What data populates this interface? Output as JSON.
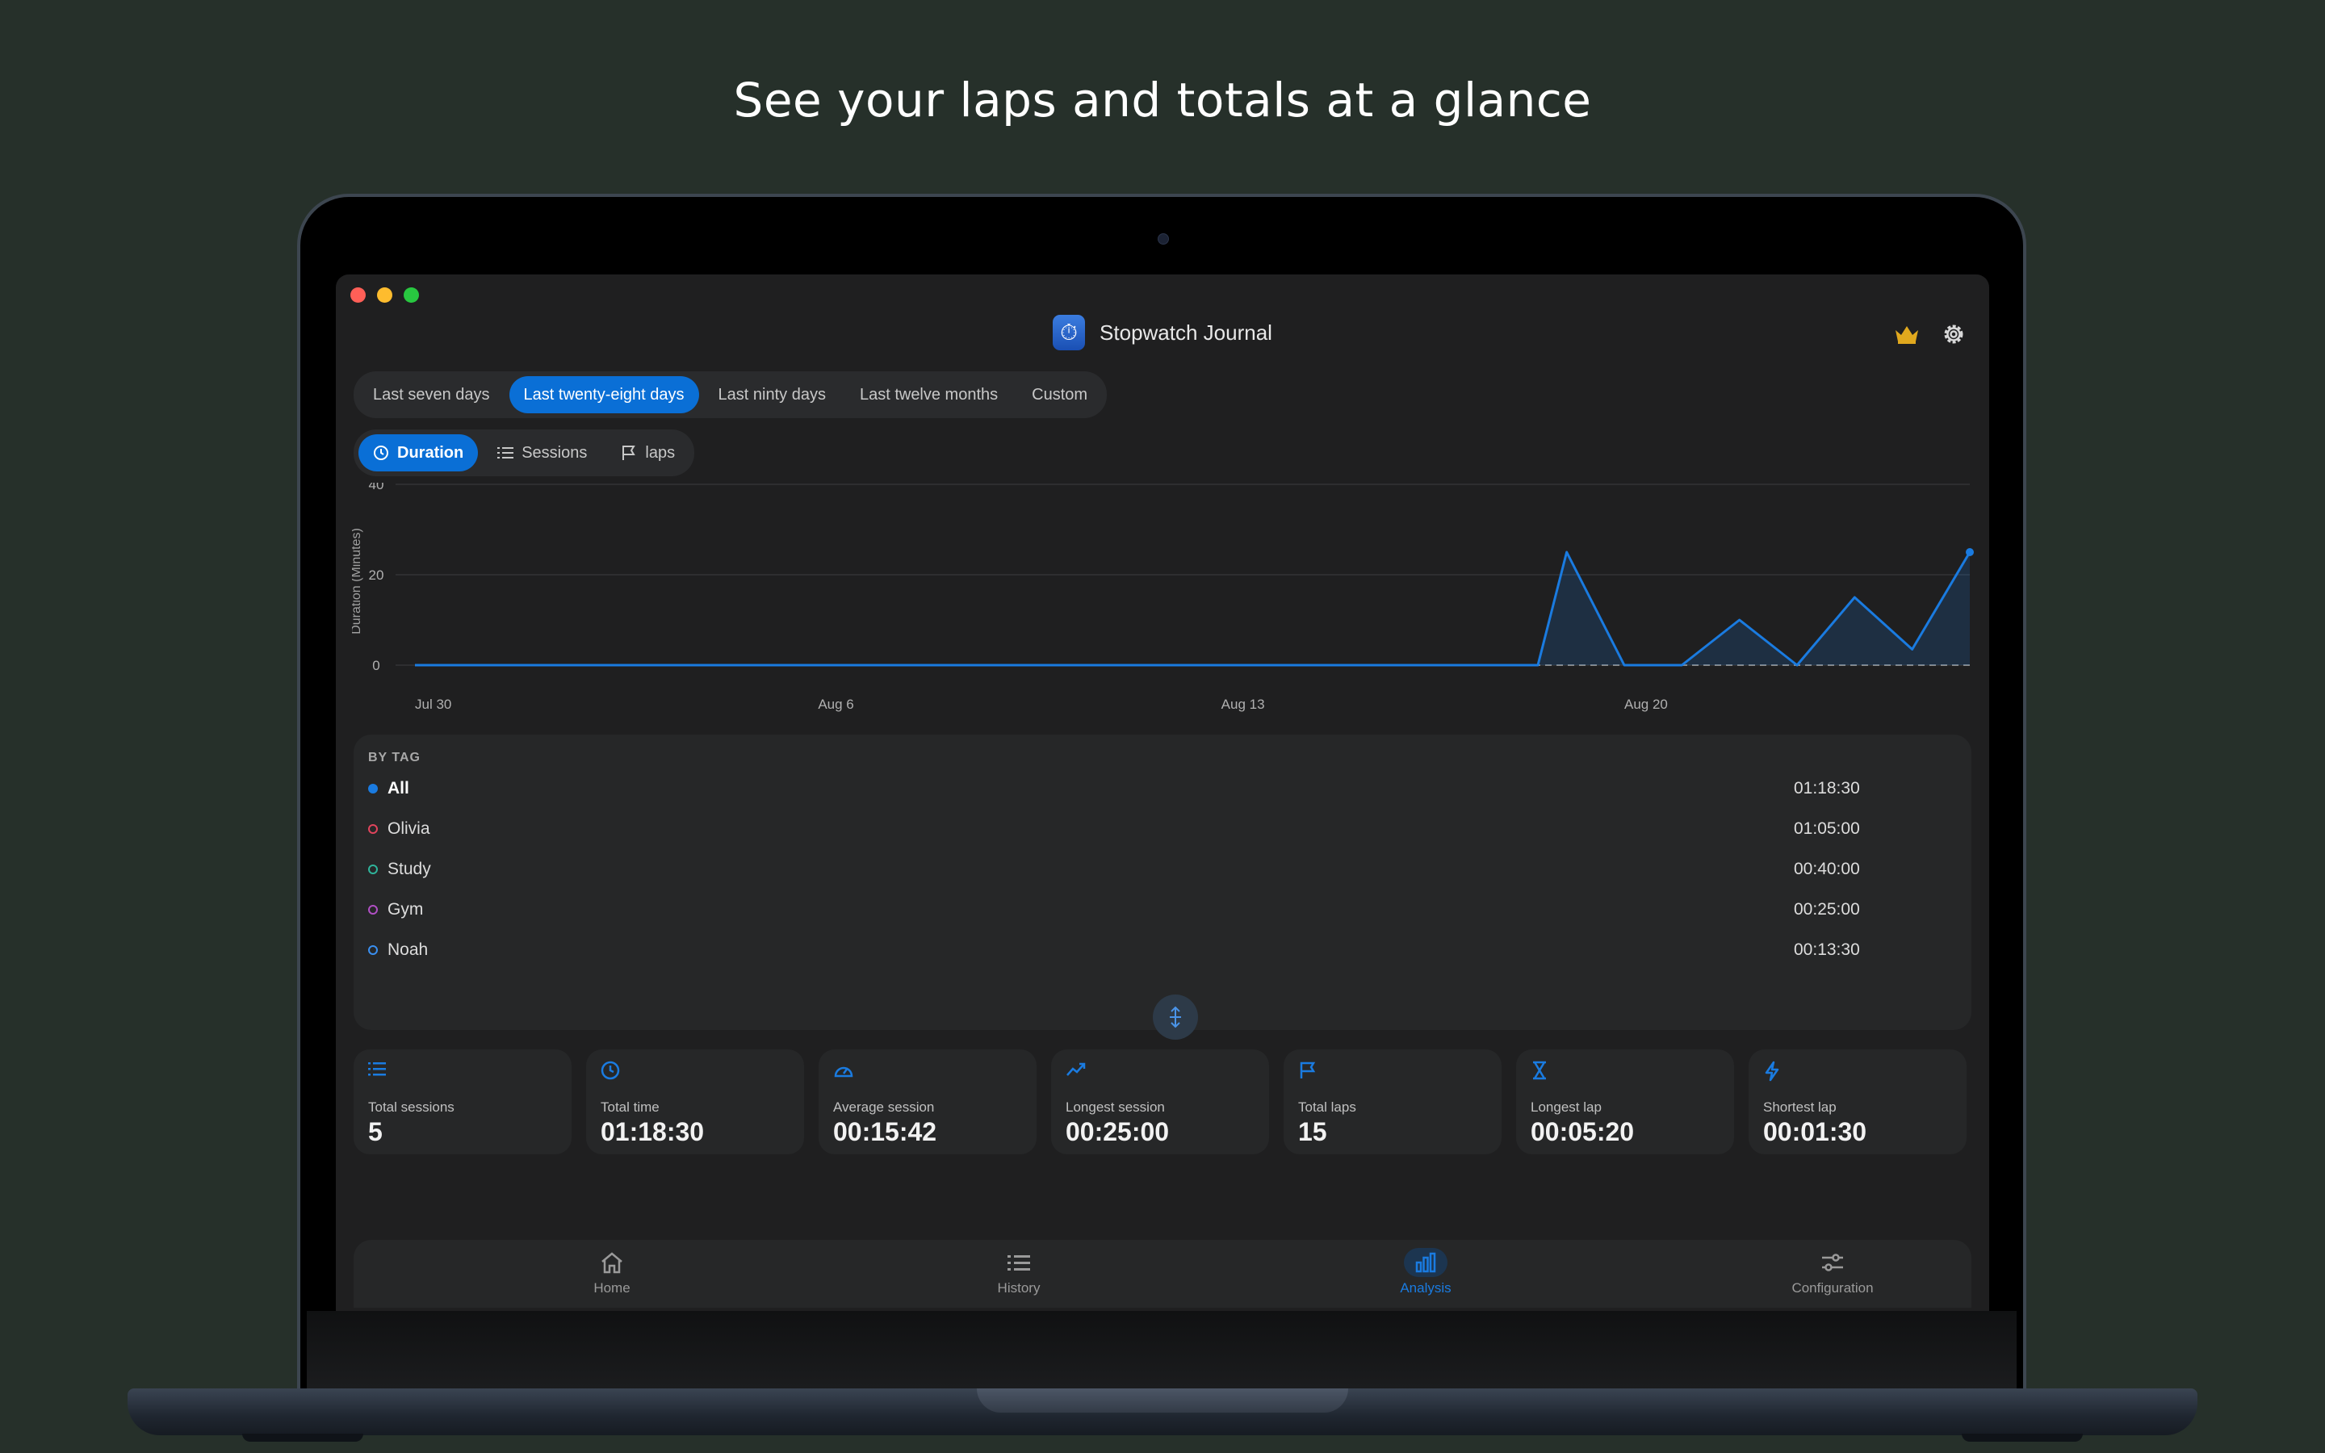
{
  "headline": "See your laps and totals at a glance",
  "window": {
    "title": "Stopwatch Journal",
    "app_icon": "stopwatch-app-icon",
    "traffic_colors": [
      "#ff5f57",
      "#febc2e",
      "#28c840"
    ]
  },
  "range_tabs": [
    {
      "label": "Last seven days",
      "active": false
    },
    {
      "label": "Last twenty-eight days",
      "active": true
    },
    {
      "label": "Last ninty days",
      "active": false
    },
    {
      "label": "Last twelve months",
      "active": false
    },
    {
      "label": "Custom",
      "active": false
    }
  ],
  "metric_tabs": [
    {
      "label": "Duration",
      "icon": "clock-icon",
      "active": true
    },
    {
      "label": "Sessions",
      "icon": "list-icon",
      "active": false
    },
    {
      "label": "laps",
      "icon": "flag-icon",
      "active": false
    }
  ],
  "chart_data": {
    "type": "area",
    "ylabel": "Duration (Minutes)",
    "ylim": [
      0,
      40
    ],
    "yticks": [
      "40",
      "20",
      "0"
    ],
    "yticks_values": [
      40,
      20,
      0
    ],
    "x_tick_labels": [
      "Jul 30",
      "Aug 6",
      "Aug 13",
      "Aug 20"
    ],
    "x_tick_days": [
      0,
      7,
      14,
      21
    ],
    "x_days": [
      0,
      1,
      2,
      3,
      4,
      5,
      6,
      7,
      8,
      9,
      10,
      11,
      12,
      13,
      14,
      15,
      16,
      17,
      18,
      19,
      19.5,
      20,
      21,
      22,
      23,
      24,
      25,
      26,
      27
    ],
    "values": [
      0,
      0,
      0,
      0,
      0,
      0,
      0,
      0,
      0,
      0,
      0,
      0,
      0,
      0,
      0,
      0,
      0,
      0,
      0,
      0,
      0,
      25,
      0,
      0,
      10,
      0,
      15,
      3.5,
      25
    ],
    "color": "#1a7be0",
    "grid": true
  },
  "tags": {
    "title": "BY TAG",
    "items": [
      {
        "name": "All",
        "value": "01:18:30",
        "color": "#1a7be0",
        "filled": true
      },
      {
        "name": "Olivia",
        "value": "01:05:00",
        "color": "#e0445c",
        "filled": false
      },
      {
        "name": "Study",
        "value": "00:40:00",
        "color": "#2fb39a",
        "filled": false
      },
      {
        "name": "Gym",
        "value": "00:25:00",
        "color": "#b04fc4",
        "filled": false
      },
      {
        "name": "Noah",
        "value": "00:13:30",
        "color": "#3a8ff0",
        "filled": false
      }
    ]
  },
  "stats": [
    {
      "label": "Total sessions",
      "value": "5",
      "icon": "list-icon"
    },
    {
      "label": "Total time",
      "value": "01:18:30",
      "icon": "clock-icon"
    },
    {
      "label": "Average session",
      "value": "00:15:42",
      "icon": "speedometer-icon"
    },
    {
      "label": "Longest session",
      "value": "00:25:00",
      "icon": "trend-up-icon"
    },
    {
      "label": "Total laps",
      "value": "15",
      "icon": "flag-icon"
    },
    {
      "label": "Longest lap",
      "value": "00:05:20",
      "icon": "hourglass-icon"
    },
    {
      "label": "Shortest lap",
      "value": "00:01:30",
      "icon": "bolt-icon"
    }
  ],
  "tabbar": [
    {
      "label": "Home",
      "icon": "home-icon",
      "active": false
    },
    {
      "label": "History",
      "icon": "list-icon",
      "active": false
    },
    {
      "label": "Analysis",
      "icon": "bar-chart-icon",
      "active": true
    },
    {
      "label": "Configuration",
      "icon": "sliders-icon",
      "active": false
    }
  ],
  "accent_color": "#0a6fd6"
}
